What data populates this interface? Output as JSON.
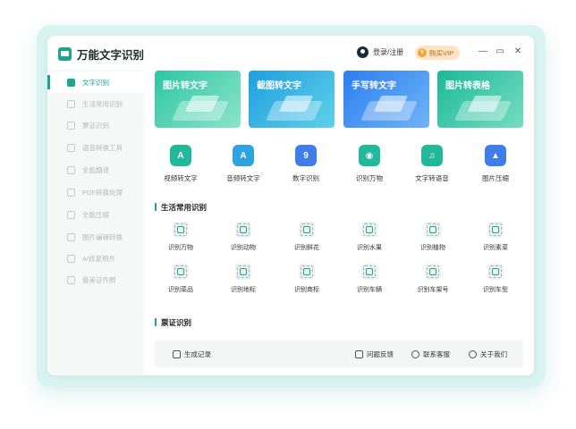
{
  "app": {
    "title": "万能文字识别"
  },
  "header": {
    "login_label": "登录/注册",
    "vip_label": "购买VIP",
    "vip_badge": "V"
  },
  "window_controls": {
    "minimize": "—",
    "maximize": "▭",
    "close": "✕"
  },
  "sidebar": {
    "items": [
      {
        "label": "文字识别",
        "active": true
      },
      {
        "label": "生活常用识别"
      },
      {
        "label": "票证识别"
      },
      {
        "label": "语音转换工具"
      },
      {
        "label": "全能翻译"
      },
      {
        "label": "PDF转换处理"
      },
      {
        "label": "全能压缩"
      },
      {
        "label": "图片编辑转换"
      },
      {
        "label": "AI修复照片"
      },
      {
        "label": "最美证件照"
      }
    ]
  },
  "banners": [
    {
      "title": "图片转文字"
    },
    {
      "title": "截图转文字"
    },
    {
      "title": "手写转文字"
    },
    {
      "title": "图片转表格"
    }
  ],
  "tools": [
    {
      "label": "视频转文字",
      "icon": "video-text-icon",
      "glyph": "A",
      "color": "#22b89a"
    },
    {
      "label": "音频转文字",
      "icon": "audio-text-icon",
      "glyph": "A",
      "color": "#2fa3e0"
    },
    {
      "label": "数字识别",
      "icon": "number-icon",
      "glyph": "9",
      "color": "#3f7de8"
    },
    {
      "label": "识别万物",
      "icon": "eye-scan-icon",
      "glyph": "◉",
      "color": "#22b89a"
    },
    {
      "label": "文字转语音",
      "icon": "text-voice-icon",
      "glyph": "♫",
      "color": "#22b89a"
    },
    {
      "label": "图片压缩",
      "icon": "image-compress-icon",
      "glyph": "▲",
      "color": "#3f7de8"
    }
  ],
  "sections": {
    "life": {
      "title": "生活常用识别"
    },
    "ticket": {
      "title": "票证识别"
    }
  },
  "life_items": [
    {
      "label": "识别万物"
    },
    {
      "label": "识别动物"
    },
    {
      "label": "识别鲜花"
    },
    {
      "label": "识别水果"
    },
    {
      "label": "识别植物"
    },
    {
      "label": "识别素菜"
    },
    {
      "label": "识别菜品"
    },
    {
      "label": "识别地标"
    },
    {
      "label": "识别商标"
    },
    {
      "label": "识别车辆"
    },
    {
      "label": "识别车架号"
    },
    {
      "label": "识别车型"
    }
  ],
  "footer": {
    "history": "生成记录",
    "feedback": "问题反馈",
    "support": "联系客服",
    "about": "关于我们"
  },
  "colors": {
    "accent": "#1aa58c",
    "backdrop": "#d9f3f0"
  }
}
